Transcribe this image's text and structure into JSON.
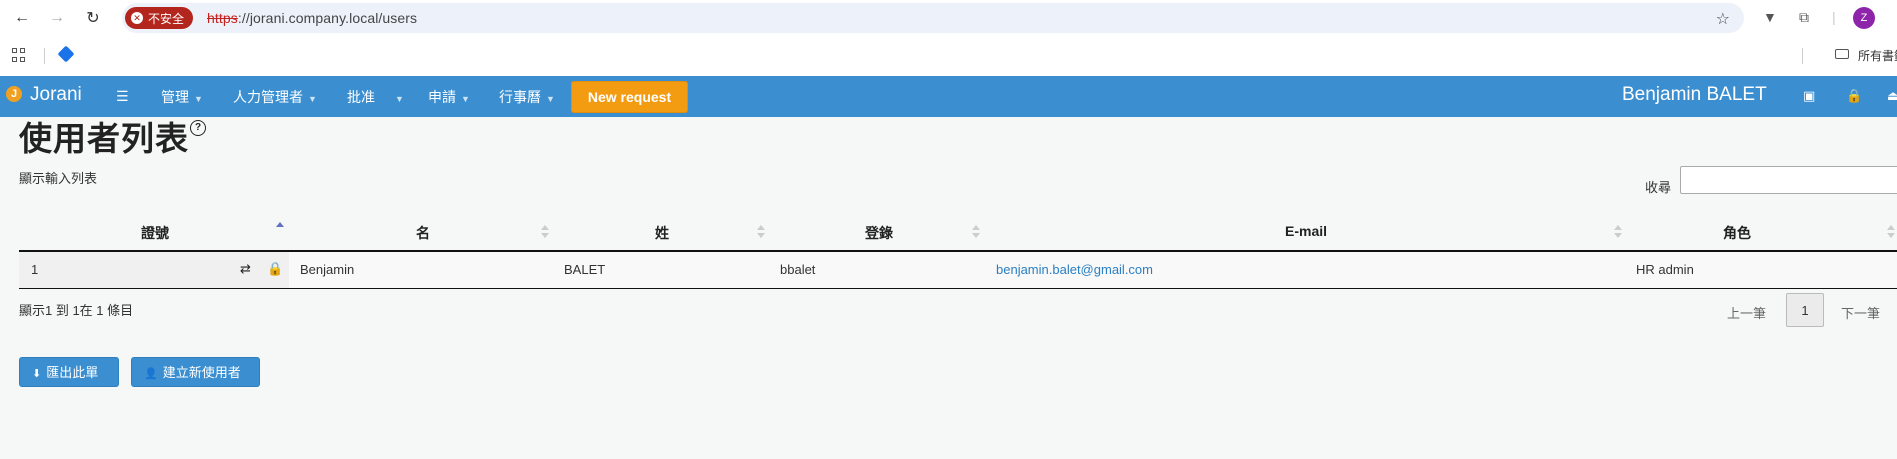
{
  "browser": {
    "security_label": "不安全",
    "url_scheme": "https",
    "url_rest": "://jorani.company.local/users",
    "profile_initial": "Z",
    "all_bookmarks_label": "所有書籤"
  },
  "navbar": {
    "brand": "Jorani",
    "menu": [
      {
        "label": "管理"
      },
      {
        "label": "人力管理者"
      },
      {
        "label": "批准"
      },
      {
        "label": "申請"
      },
      {
        "label": "行事曆"
      }
    ],
    "new_request_label": "New request",
    "user_name": "Benjamin BALET"
  },
  "page": {
    "title": "使用者列表",
    "subtitle": "顯示輸入列表",
    "search_label": "收尋",
    "search_value": ""
  },
  "table": {
    "columns": [
      "證號",
      "名",
      "姓",
      "登錄",
      "E-mail",
      "角色"
    ],
    "rows": [
      {
        "id": "1",
        "first_name": "Benjamin",
        "last_name": "BALET",
        "login": "bbalet",
        "email": "benjamin.balet@gmail.com",
        "role": "HR admin"
      }
    ]
  },
  "footer": {
    "info": "顯示1 到 1在 1 條目",
    "prev_label": "上一筆",
    "current_page": "1",
    "next_label": "下一筆"
  },
  "actions": {
    "export_label": "匯出此單",
    "create_label": "建立新使用者"
  },
  "colors": {
    "navbar": "#3b8fd1",
    "new_request": "#f39c12",
    "link": "#2a7fc4",
    "insecure": "#b3261e"
  }
}
